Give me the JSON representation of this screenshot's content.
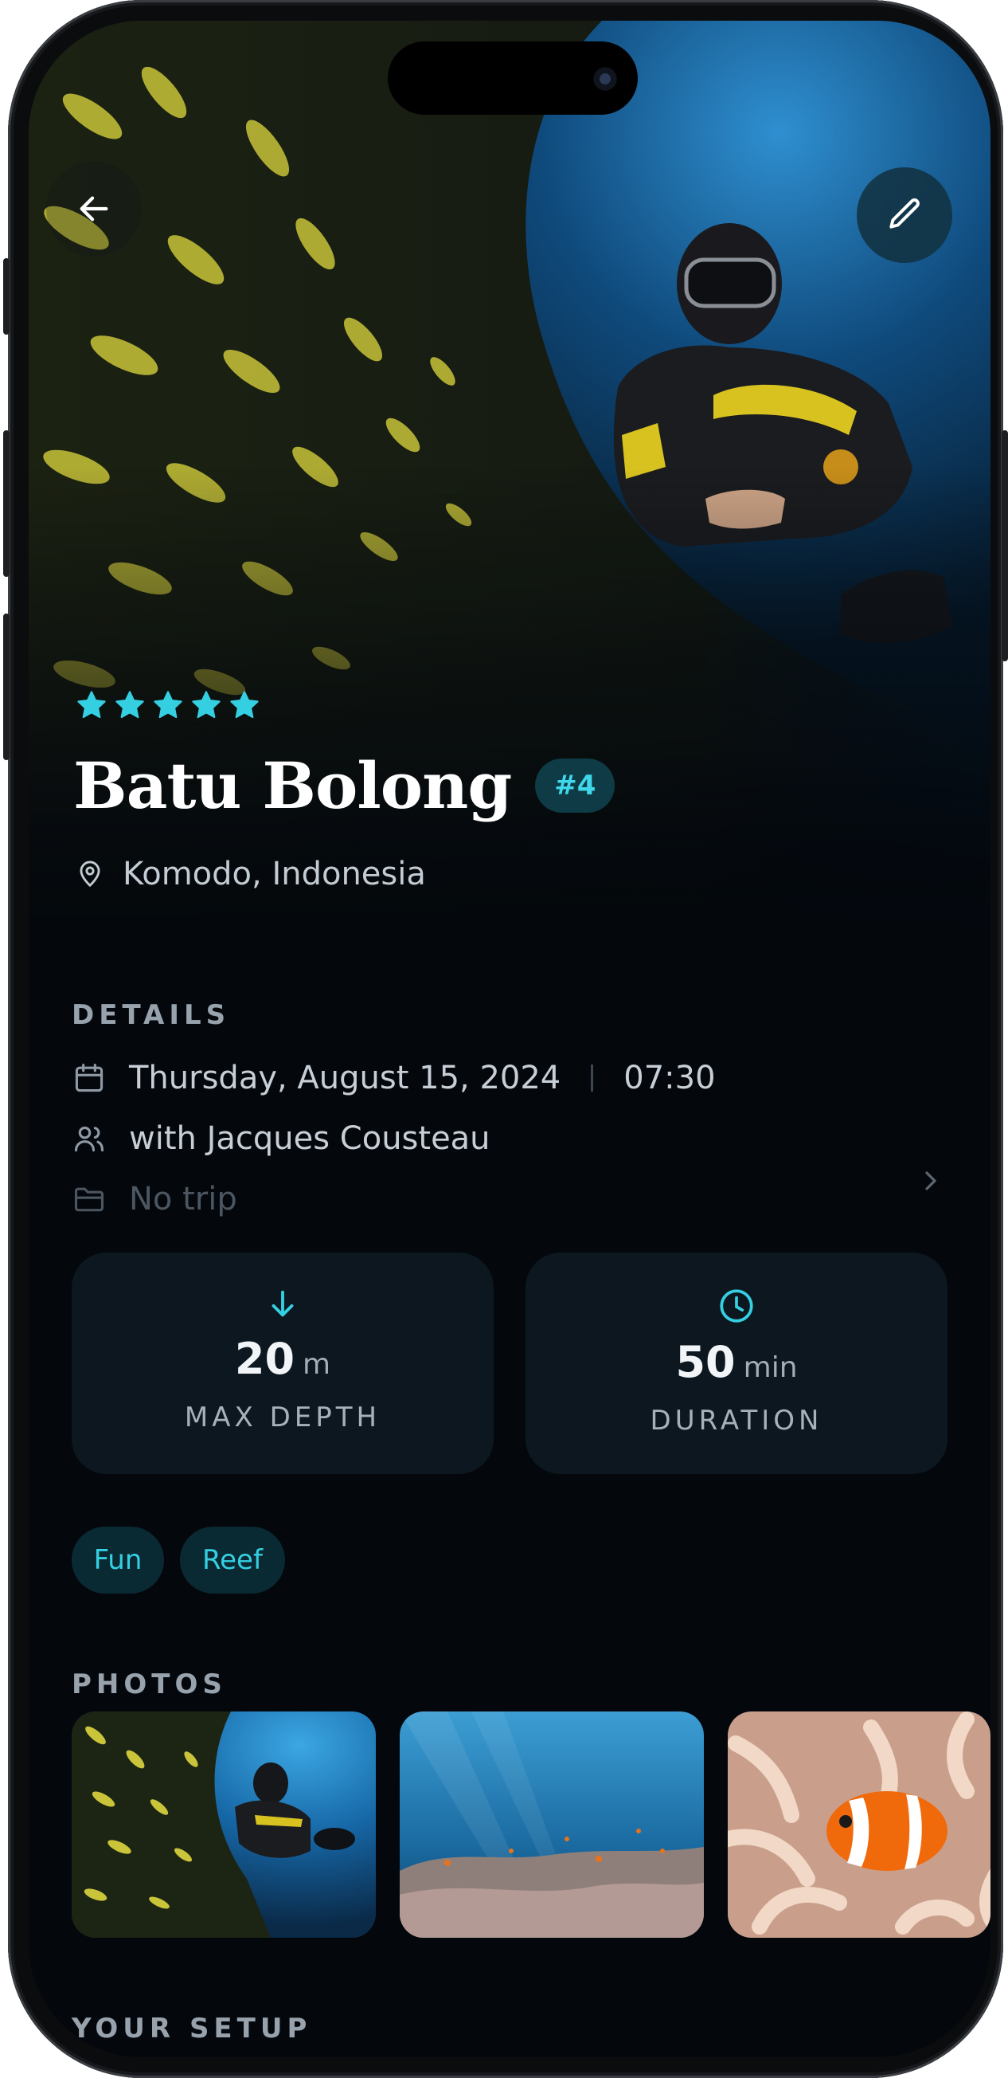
{
  "header": {
    "back_icon": "arrow-left-icon",
    "edit_icon": "pencil-icon"
  },
  "dive": {
    "rating": 5,
    "rating_max": 5,
    "name": "Batu Bolong",
    "rank": "#4",
    "location": "Komodo, Indonesia"
  },
  "details": {
    "section_title": "DETAILS",
    "date": "Thursday, August 15, 2024",
    "time": "07:30",
    "buddy": "with Jacques Cousteau",
    "trip": "No trip"
  },
  "stats": [
    {
      "value": "20",
      "unit": "m",
      "label": "MAX DEPTH",
      "icon": "arrow-down-icon"
    },
    {
      "value": "50",
      "unit": "min",
      "label": "DURATION",
      "icon": "clock-icon"
    }
  ],
  "tags": [
    "Fun",
    "Reef"
  ],
  "photos": {
    "section_title": "PHOTOS",
    "items": [
      "diver-with-fish-school",
      "coral-reef",
      "clownfish-anemone"
    ]
  },
  "setup": {
    "section_title": "YOUR SETUP"
  },
  "colors": {
    "accent": "#35cfe2",
    "background": "#04080d",
    "card": "#0c171f"
  }
}
